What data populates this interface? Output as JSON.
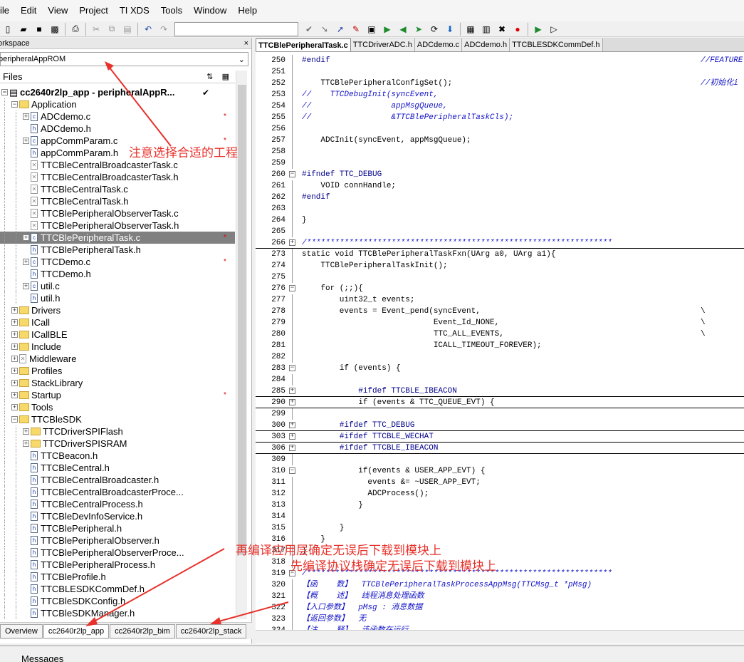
{
  "menu": [
    "ile",
    "Edit",
    "View",
    "Project",
    "TI XDS",
    "Tools",
    "Window",
    "Help"
  ],
  "workspace": {
    "title": "orkspace",
    "close": "×",
    "combo": "peripheralAppROM",
    "files_label": "Files",
    "root": "cc2640r2lp_app - peripheralAppR...",
    "root_check": "✔",
    "tabs": [
      "Overview",
      "cc2640r2lp_app",
      "cc2640r2lp_bim",
      "cc2640r2lp_stack"
    ]
  },
  "tree": [
    {
      "label": "Application",
      "type": "folder",
      "depth": 1,
      "exp": "−"
    },
    {
      "label": "ADCdemo.c",
      "type": "c",
      "depth": 2,
      "exp": "+",
      "star": true
    },
    {
      "label": "ADCdemo.h",
      "type": "h",
      "depth": 2,
      "exp": ""
    },
    {
      "label": "appCommParam.c",
      "type": "c",
      "depth": 2,
      "exp": "+",
      "star": true
    },
    {
      "label": "appCommParam.h",
      "type": "h",
      "depth": 2,
      "exp": ""
    },
    {
      "label": "TTCBleCentralBroadcasterTask.c",
      "type": "x",
      "depth": 2,
      "exp": ""
    },
    {
      "label": "TTCBleCentralBroadcasterTask.h",
      "type": "x",
      "depth": 2,
      "exp": ""
    },
    {
      "label": "TTCBleCentralTask.c",
      "type": "x",
      "depth": 2,
      "exp": ""
    },
    {
      "label": "TTCBleCentralTask.h",
      "type": "x",
      "depth": 2,
      "exp": ""
    },
    {
      "label": "TTCBlePeripheralObserverTask.c",
      "type": "x",
      "depth": 2,
      "exp": ""
    },
    {
      "label": "TTCBlePeripheralObserverTask.h",
      "type": "x",
      "depth": 2,
      "exp": ""
    },
    {
      "label": "TTCBlePeripheralTask.c",
      "type": "c",
      "depth": 2,
      "exp": "+",
      "star": true,
      "sel": true
    },
    {
      "label": "TTCBlePeripheralTask.h",
      "type": "h",
      "depth": 2,
      "exp": ""
    },
    {
      "label": "TTCDemo.c",
      "type": "c",
      "depth": 2,
      "exp": "+",
      "star": true
    },
    {
      "label": "TTCDemo.h",
      "type": "h",
      "depth": 2,
      "exp": ""
    },
    {
      "label": "util.c",
      "type": "c",
      "depth": 2,
      "exp": "+"
    },
    {
      "label": "util.h",
      "type": "h",
      "depth": 2,
      "exp": ""
    },
    {
      "label": "Drivers",
      "type": "folder",
      "depth": 1,
      "exp": "+"
    },
    {
      "label": "ICall",
      "type": "folder",
      "depth": 1,
      "exp": "+"
    },
    {
      "label": "ICallBLE",
      "type": "folder",
      "depth": 1,
      "exp": "+"
    },
    {
      "label": "Include",
      "type": "folder",
      "depth": 1,
      "exp": "+"
    },
    {
      "label": "Middleware",
      "type": "x",
      "depth": 1,
      "exp": "+"
    },
    {
      "label": "Profiles",
      "type": "folder",
      "depth": 1,
      "exp": "+"
    },
    {
      "label": "StackLibrary",
      "type": "folder",
      "depth": 1,
      "exp": "+"
    },
    {
      "label": "Startup",
      "type": "folder",
      "depth": 1,
      "exp": "+",
      "star": true
    },
    {
      "label": "Tools",
      "type": "folder",
      "depth": 1,
      "exp": "+"
    },
    {
      "label": "TTCBleSDK",
      "type": "folder",
      "depth": 1,
      "exp": "−"
    },
    {
      "label": "TTCDriverSPIFlash",
      "type": "folder",
      "depth": 2,
      "exp": "+"
    },
    {
      "label": "TTCDriverSPISRAM",
      "type": "folder",
      "depth": 2,
      "exp": "+"
    },
    {
      "label": "TTCBeacon.h",
      "type": "h",
      "depth": 2,
      "exp": ""
    },
    {
      "label": "TTCBleCentral.h",
      "type": "h",
      "depth": 2,
      "exp": ""
    },
    {
      "label": "TTCBleCentralBroadcaster.h",
      "type": "h",
      "depth": 2,
      "exp": ""
    },
    {
      "label": "TTCBleCentralBroadcasterProce...",
      "type": "h",
      "depth": 2,
      "exp": ""
    },
    {
      "label": "TTCBleCentralProcess.h",
      "type": "h",
      "depth": 2,
      "exp": ""
    },
    {
      "label": "TTCBleDevInfoService.h",
      "type": "h",
      "depth": 2,
      "exp": ""
    },
    {
      "label": "TTCBlePeripheral.h",
      "type": "h",
      "depth": 2,
      "exp": ""
    },
    {
      "label": "TTCBlePeripheralObserver.h",
      "type": "h",
      "depth": 2,
      "exp": ""
    },
    {
      "label": "TTCBlePeripheralObserverProce...",
      "type": "h",
      "depth": 2,
      "exp": ""
    },
    {
      "label": "TTCBlePeripheralProcess.h",
      "type": "h",
      "depth": 2,
      "exp": ""
    },
    {
      "label": "TTCBleProfile.h",
      "type": "h",
      "depth": 2,
      "exp": ""
    },
    {
      "label": "TTCBLESDKCommDef.h",
      "type": "h",
      "depth": 2,
      "exp": ""
    },
    {
      "label": "TTCBleSDKConfig.h",
      "type": "h",
      "depth": 2,
      "exp": ""
    },
    {
      "label": "TTCBleSDKManager.h",
      "type": "h",
      "depth": 2,
      "exp": ""
    }
  ],
  "editor_tabs": [
    "TTCBlePeripheralTask.c",
    "TTCDriverADC.h",
    "ADCdemo.c",
    "ADCdemo.h",
    "TTCBLESDKCommDef.h"
  ],
  "code": [
    {
      "n": "250",
      "t": "#endif",
      "c": "pp",
      "r": "//FEATURE"
    },
    {
      "n": "251",
      "t": ""
    },
    {
      "n": "252",
      "t": "    TTCBlePeripheralConfigSet();",
      "r": "//初始化i"
    },
    {
      "n": "253",
      "t": "//    TTCDebugInit(syncEvent,",
      "c": "cm"
    },
    {
      "n": "254",
      "t": "//                 appMsgQueue,",
      "c": "cm"
    },
    {
      "n": "255",
      "t": "//                 &TTCBlePeripheralTaskCls);",
      "c": "cm"
    },
    {
      "n": "256",
      "t": ""
    },
    {
      "n": "257",
      "t": "    ADCInit(syncEvent, appMsgQueue);"
    },
    {
      "n": "258",
      "t": ""
    },
    {
      "n": "259",
      "t": ""
    },
    {
      "n": "260",
      "t": "#ifndef TTC_DEBUG",
      "c": "pp",
      "f": "−"
    },
    {
      "n": "261",
      "t": "    VOID connHandle;"
    },
    {
      "n": "262",
      "t": "#endif",
      "c": "pp"
    },
    {
      "n": "263",
      "t": ""
    },
    {
      "n": "264",
      "t": "}",
      "f": "end"
    },
    {
      "n": "265",
      "t": ""
    },
    {
      "n": "266",
      "t": "/*****************************************************************",
      "c": "cm",
      "f": "+",
      "u": true
    },
    {
      "n": "273",
      "t": "static void TTCBlePeripheralTaskFxn(UArg a0, UArg a1){"
    },
    {
      "n": "274",
      "t": "    TTCBlePeripheralTaskInit();"
    },
    {
      "n": "275",
      "t": ""
    },
    {
      "n": "276",
      "t": "    for (;;){",
      "f": "−"
    },
    {
      "n": "277",
      "t": "        uint32_t events;"
    },
    {
      "n": "278",
      "t": "        events = Event_pend(syncEvent,",
      "r": "\\"
    },
    {
      "n": "279",
      "t": "                            Event_Id_NONE,",
      "r": "\\"
    },
    {
      "n": "280",
      "t": "                            TTC_ALL_EVENTS,",
      "r": "\\"
    },
    {
      "n": "281",
      "t": "                            ICALL_TIMEOUT_FOREVER);"
    },
    {
      "n": "282",
      "t": ""
    },
    {
      "n": "283",
      "t": "        if (events) {",
      "f": "−"
    },
    {
      "n": "284",
      "t": ""
    },
    {
      "n": "285",
      "t": "            #ifdef TTCBLE_IBEACON",
      "c": "pp",
      "f": "+",
      "u": true
    },
    {
      "n": "290",
      "t": "            if (events & TTC_QUEUE_EVT) {",
      "f": "+",
      "u": true
    },
    {
      "n": "299",
      "t": ""
    },
    {
      "n": "300",
      "t": "        #ifdef TTC_DEBUG",
      "c": "pp",
      "f": "+",
      "u": true
    },
    {
      "n": "303",
      "t": "        #ifdef TTCBLE_WECHAT",
      "c": "pp",
      "f": "+",
      "u": true
    },
    {
      "n": "306",
      "t": "        #ifdef TTCBLE_IBEACON",
      "c": "pp",
      "f": "+",
      "u": true
    },
    {
      "n": "309",
      "t": ""
    },
    {
      "n": "310",
      "t": "            if(events & USER_APP_EVT) {",
      "f": "−"
    },
    {
      "n": "311",
      "t": "              events &= ~USER_APP_EVT;"
    },
    {
      "n": "312",
      "t": "              ADCProcess();"
    },
    {
      "n": "313",
      "t": "            }",
      "f": "end"
    },
    {
      "n": "314",
      "t": ""
    },
    {
      "n": "315",
      "t": "        }",
      "f": "end"
    },
    {
      "n": "316",
      "t": "    }",
      "f": "end"
    },
    {
      "n": "317",
      "t": "}"
    },
    {
      "n": "318",
      "t": ""
    },
    {
      "n": "319",
      "t": "/*****************************************************************",
      "c": "cm",
      "f": "−"
    },
    {
      "n": "320",
      "t": "【函    数】  TTCBlePeripheralTaskProcessAppMsg(TTCMsg_t *pMsg)",
      "c": "cm"
    },
    {
      "n": "321",
      "t": "【概    述】  线程消息处理函数",
      "c": "cm"
    },
    {
      "n": "322",
      "t": "【入口参数】  pMsg : 消息数据",
      "c": "cm"
    },
    {
      "n": "323",
      "t": "【返回参数】  无",
      "c": "cm"
    },
    {
      "n": "324",
      "t": "【注    释】  该函数在运行...",
      "c": "cm"
    }
  ],
  "annotations": {
    "select_project": "注意选择合适的工程",
    "app_layer": "再编译应用层确定无误后下载到模块上",
    "stack_layer": "先编译协议栈确定无误后下载到模块上",
    "color": "#e8312a"
  },
  "messages_label": "Messages"
}
